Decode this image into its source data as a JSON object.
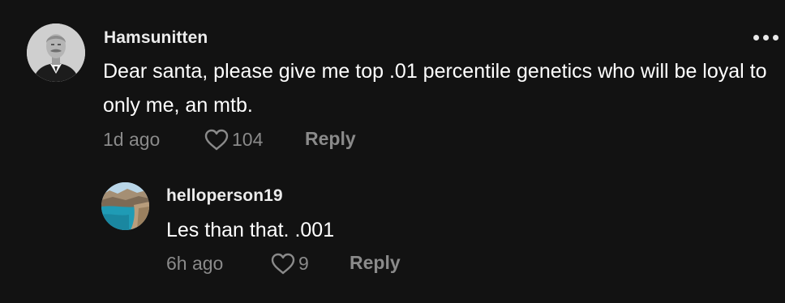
{
  "comment": {
    "username": "Hamsunitten",
    "text": "Dear santa, please give me top .01 percentile genetics who will be loyal to only me, an mtb.",
    "time": "1d ago",
    "likes": "104",
    "reply_label": "Reply",
    "more_icon": "more-horizontal-icon"
  },
  "reply": {
    "username": "helloperson19",
    "text": "Les than that. .001",
    "time": "6h ago",
    "likes": "9",
    "reply_label": "Reply"
  },
  "colors": {
    "background": "#121212",
    "text": "#ffffff",
    "muted": "#8a8a8a"
  }
}
